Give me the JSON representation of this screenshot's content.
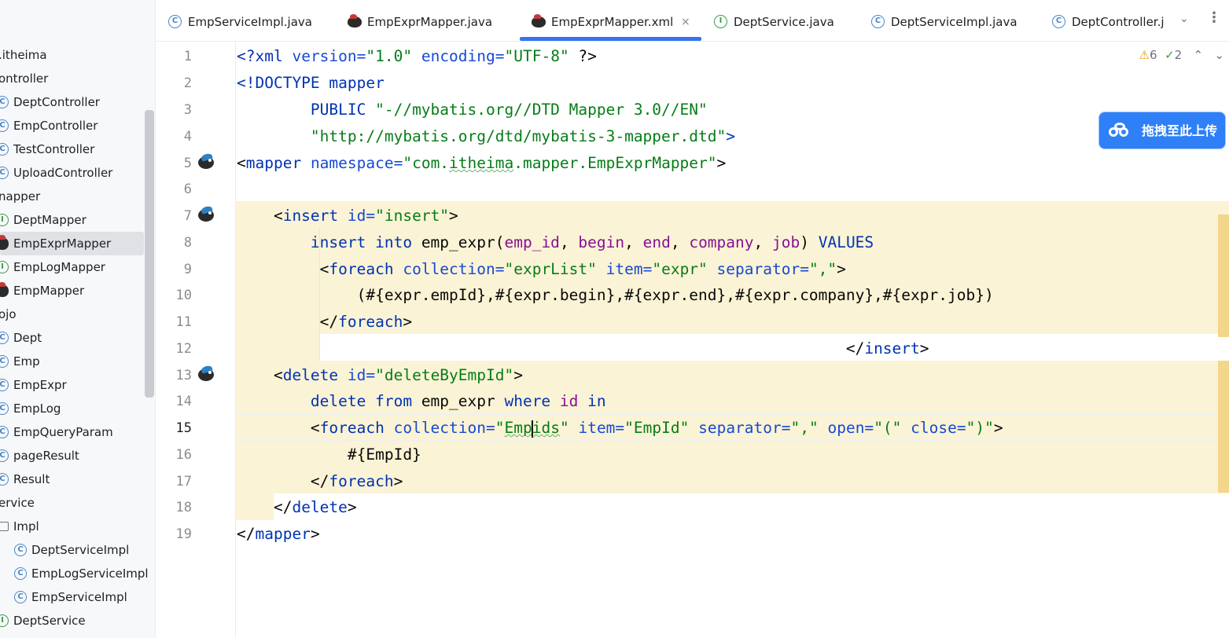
{
  "sidebar": {
    "items": [
      {
        "label": ".itheima",
        "icon": "none"
      },
      {
        "label": "ontroller",
        "icon": "none"
      },
      {
        "label": "DeptController",
        "icon": "class-icon"
      },
      {
        "label": "EmpController",
        "icon": "class-icon"
      },
      {
        "label": "TestController",
        "icon": "class-icon"
      },
      {
        "label": "UploadController",
        "icon": "class-icon"
      },
      {
        "label": "napper",
        "icon": "none"
      },
      {
        "label": "DeptMapper",
        "icon": "interface-icon"
      },
      {
        "label": "EmpExprMapper",
        "icon": "mybatis-icon"
      },
      {
        "label": "EmpLogMapper",
        "icon": "interface-icon"
      },
      {
        "label": "EmpMapper",
        "icon": "mybatis-icon"
      },
      {
        "label": "ojo",
        "icon": "none"
      },
      {
        "label": "Dept",
        "icon": "class-icon"
      },
      {
        "label": "Emp",
        "icon": "class-icon"
      },
      {
        "label": "EmpExpr",
        "icon": "class-icon"
      },
      {
        "label": "EmpLog",
        "icon": "class-icon"
      },
      {
        "label": "EmpQueryParam",
        "icon": "class-icon"
      },
      {
        "label": "pageResult",
        "icon": "class-icon"
      },
      {
        "label": "Result",
        "icon": "class-icon"
      },
      {
        "label": "ervice",
        "icon": "none"
      },
      {
        "label": "Impl",
        "icon": "folder-icon"
      },
      {
        "label": "DeptServiceImpl",
        "icon": "class-icon"
      },
      {
        "label": "EmpLogServiceImpl",
        "icon": "class-icon"
      },
      {
        "label": "EmpServiceImpl",
        "icon": "class-icon"
      },
      {
        "label": "DeptService",
        "icon": "interface-icon"
      }
    ],
    "selected": "EmpExprMapper"
  },
  "tabs": [
    {
      "label": "EmpServiceImpl.java",
      "icon": "class-icon"
    },
    {
      "label": "EmpExprMapper.java",
      "icon": "mybatis-icon"
    },
    {
      "label": "EmpExprMapper.xml",
      "icon": "mybatis-icon",
      "active": true,
      "close": "×"
    },
    {
      "label": "DeptService.java",
      "icon": "interface-icon"
    },
    {
      "label": "DeptServiceImpl.java",
      "icon": "class-icon"
    },
    {
      "label": "DeptController.j",
      "icon": "class-icon"
    }
  ],
  "tabs_more_icon": "chevron-down-icon",
  "tabs_menu_icon": "more-vertical-icon",
  "editor": {
    "line_numbers": [
      "1",
      "2",
      "3",
      "4",
      "5",
      "6",
      "7",
      "8",
      "9",
      "10",
      "11",
      "12",
      "13",
      "14",
      "15",
      "16",
      "17",
      "18",
      "19"
    ],
    "current_line": 15,
    "inspections": {
      "warnings": "6",
      "weak_warnings": "2"
    },
    "code": {
      "l1": {
        "a": "<?",
        "b": "xml",
        "c": " version=",
        "d": "\"1.0\"",
        "e": " encoding=",
        "f": "\"UTF-8\"",
        "g": " ?>"
      },
      "l2": {
        "a": "<!DOCTYPE mapper"
      },
      "l3": {
        "a": "        PUBLIC ",
        "b": "\"-//mybatis.org//DTD Mapper 3.0//EN\""
      },
      "l4": {
        "a": "        ",
        "b": "\"http://mybatis.org/dtd/mybatis-3-mapper.dtd\"",
        "c": ">"
      },
      "l5": {
        "a": "<",
        "b": "mapper",
        "c": " namespace=",
        "d": "\"com.",
        "e": "itheima",
        "f": ".mapper.EmpExprMapper\"",
        "g": ">"
      },
      "l7": {
        "a": "    <",
        "b": "insert",
        "c": " id=",
        "d": "\"insert\"",
        "e": ">"
      },
      "l8": {
        "a": "        insert into ",
        "b": "emp_expr",
        "c": "(",
        "d": "emp_id",
        "e": ", ",
        "f": "begin",
        "g": ", ",
        "h": "end",
        "i": ", ",
        "j": "company",
        "k": ", ",
        "l": "job",
        "m": ") ",
        "n": "VALUES"
      },
      "l9": {
        "a": "         <",
        "b": "foreach",
        "c": " collection=",
        "d": "\"exprList\"",
        "e": " item=",
        "f": "\"expr\"",
        "g": " separator=",
        "h": "\",\"",
        "i": ">"
      },
      "l10": {
        "a": "             (#{expr.empId},#{expr.begin},#{expr.end},#{expr.company},#{expr.job})"
      },
      "l11": {
        "a": "         </",
        "b": "foreach",
        "c": ">"
      },
      "l12": {
        "a": "                                                                  </",
        "b": "insert",
        "c": ">"
      },
      "l13": {
        "a": "    <",
        "b": "delete",
        "c": " id=",
        "d": "\"deleteByEmpId\"",
        "e": ">"
      },
      "l14": {
        "a": "        delete from ",
        "b": "emp_expr",
        "c": " where ",
        "d": "id",
        "e": " in"
      },
      "l15": {
        "a": "        <",
        "b": "foreach",
        "c": " collection=",
        "d": "\"",
        "e": "Emp",
        "f": "ids",
        "g": "\"",
        "h": " item=",
        "i": "\"EmpId\"",
        "j": " separator=",
        "k": "\",\"",
        "l": " open=",
        "m": "\"(\"",
        "n": " close=",
        "o": "\")\"",
        "p": ">"
      },
      "l16": {
        "a": "            #{EmpId}"
      },
      "l17": {
        "a": "        </",
        "b": "foreach",
        "c": ">"
      },
      "l18": {
        "a": "    </",
        "b": "delete",
        "c": ">"
      },
      "l19": {
        "a": "</",
        "b": "mapper",
        "c": ">"
      }
    }
  },
  "upload_button": {
    "label": "拖拽至此上传",
    "icon": "baidu-cloud-icon"
  },
  "colors": {
    "accent": "#3574f0",
    "highlight": "#fbf3d5",
    "tag": "#0033b3",
    "string": "#067d17",
    "column": "#871094"
  }
}
